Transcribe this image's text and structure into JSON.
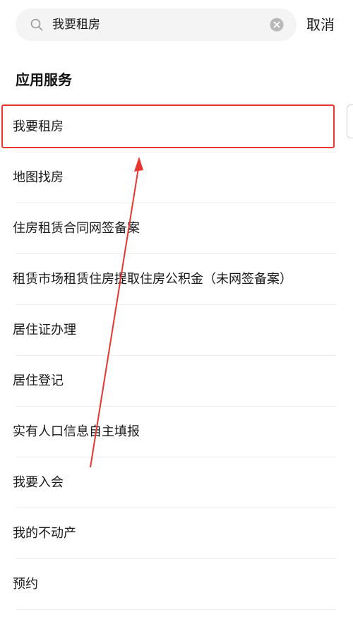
{
  "search": {
    "query": "我要租房",
    "cancel_label": "取消"
  },
  "section": {
    "title": "应用服务"
  },
  "services": [
    "我要租房",
    "地图找房",
    "住房租赁合同网签备案",
    "租赁市场租赁住房提取住房公积金（未网签备案）",
    "居住证办理",
    "居住登记",
    "实有人口信息自主填报",
    "我要入会",
    "我的不动产",
    "预约"
  ],
  "colors": {
    "highlight": "#e8352f",
    "search_bg": "#f4f4f4",
    "divider": "#ededed"
  },
  "icons": {
    "search": "search-icon",
    "clear": "clear-icon"
  }
}
